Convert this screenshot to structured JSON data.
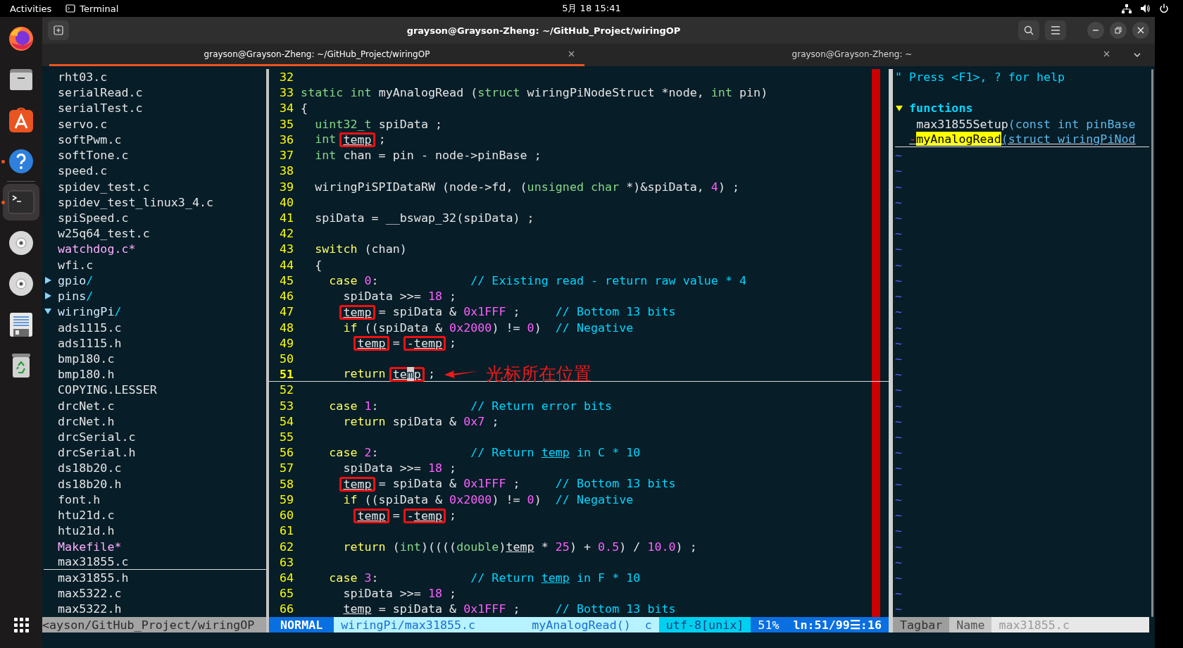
{
  "top_bar": {
    "activities": "Activities",
    "app": "Terminal",
    "clock": "5月 18 15:41"
  },
  "dock": {
    "items": [
      {
        "kind": "browser",
        "selected": false,
        "running": false
      },
      {
        "kind": "files",
        "selected": false,
        "running": false
      },
      {
        "kind": "store",
        "selected": false,
        "running": false
      },
      {
        "kind": "help",
        "selected": false,
        "running": true
      },
      {
        "kind": "terminal",
        "selected": true,
        "running": true
      },
      {
        "kind": "disc",
        "selected": false,
        "running": false
      },
      {
        "kind": "disc",
        "selected": false,
        "running": false
      },
      {
        "kind": "document",
        "selected": false,
        "running": false
      },
      {
        "kind": "trash",
        "selected": false,
        "running": false
      }
    ]
  },
  "window": {
    "title": "grayson@Grayson-Zheng: ~/GitHub_Project/wiringOP",
    "tabs": [
      {
        "label": "grayson@Grayson-Zheng: ~/GitHub_Project/wiringOP",
        "selected": true
      },
      {
        "label": "grayson@Grayson-Zheng: ~",
        "selected": false
      }
    ]
  },
  "tree": {
    "items": [
      {
        "kind": "group",
        "children": [
          {
            "kind": "file",
            "name": "rht03.c",
            "modified": false,
            "current": false
          },
          {
            "kind": "file",
            "name": "serialRead.c",
            "modified": false,
            "current": false
          },
          {
            "kind": "file",
            "name": "serialTest.c",
            "modified": false,
            "current": false
          },
          {
            "kind": "file",
            "name": "servo.c",
            "modified": false,
            "current": false
          },
          {
            "kind": "file",
            "name": "softPwm.c",
            "modified": false,
            "current": false
          },
          {
            "kind": "file",
            "name": "softTone.c",
            "modified": false,
            "current": false
          },
          {
            "kind": "file",
            "name": "speed.c",
            "modified": false,
            "current": false
          },
          {
            "kind": "file",
            "name": "spidev_test.c",
            "modified": false,
            "current": false
          },
          {
            "kind": "file",
            "name": "spidev_test_linux3_4.c",
            "modified": false,
            "current": false
          },
          {
            "kind": "file",
            "name": "spiSpeed.c",
            "modified": false,
            "current": false
          },
          {
            "kind": "file",
            "name": "w25q64_test.c",
            "modified": false,
            "current": false
          },
          {
            "kind": "file",
            "name": "watchdog.c*",
            "modified": true,
            "current": false
          },
          {
            "kind": "file",
            "name": "wfi.c",
            "modified": false,
            "current": false
          }
        ]
      },
      {
        "kind": "dir",
        "name": "gpio",
        "suffix": "/",
        "expanded": false
      },
      {
        "kind": "dir",
        "name": "pins",
        "suffix": "/",
        "expanded": false
      },
      {
        "kind": "dir",
        "name": "wiringPi",
        "suffix": "/",
        "expanded": true,
        "children": [
          {
            "kind": "file",
            "name": "ads1115.c",
            "modified": false,
            "current": false
          },
          {
            "kind": "file",
            "name": "ads1115.h",
            "modified": false,
            "current": false
          },
          {
            "kind": "file",
            "name": "bmp180.c",
            "modified": false,
            "current": false
          },
          {
            "kind": "file",
            "name": "bmp180.h",
            "modified": false,
            "current": false
          },
          {
            "kind": "file",
            "name": "COPYING.LESSER",
            "modified": false,
            "current": false
          },
          {
            "kind": "file",
            "name": "drcNet.c",
            "modified": false,
            "current": false
          },
          {
            "kind": "file",
            "name": "drcNet.h",
            "modified": false,
            "current": false
          },
          {
            "kind": "file",
            "name": "drcSerial.c",
            "modified": false,
            "current": false
          },
          {
            "kind": "file",
            "name": "drcSerial.h",
            "modified": false,
            "current": false
          },
          {
            "kind": "file",
            "name": "ds18b20.c",
            "modified": false,
            "current": false
          },
          {
            "kind": "file",
            "name": "ds18b20.h",
            "modified": false,
            "current": false
          },
          {
            "kind": "file",
            "name": "font.h",
            "modified": false,
            "current": false
          },
          {
            "kind": "file",
            "name": "htu21d.c",
            "modified": false,
            "current": false
          },
          {
            "kind": "file",
            "name": "htu21d.h",
            "modified": false,
            "current": false
          },
          {
            "kind": "file",
            "name": "Makefile*",
            "modified": true,
            "current": false
          },
          {
            "kind": "file",
            "name": "max31855.c",
            "modified": false,
            "current": true
          },
          {
            "kind": "file",
            "name": "max31855.h",
            "modified": false,
            "current": false
          },
          {
            "kind": "file",
            "name": "max5322.c",
            "modified": false,
            "current": false
          },
          {
            "kind": "file",
            "name": "max5322.h",
            "modified": false,
            "current": false
          }
        ]
      }
    ],
    "status": "<ayson/GitHub_Project/wiringOP"
  },
  "editor": {
    "lines": [
      {
        "num": "32",
        "current": false
      },
      {
        "num": "33",
        "current": false,
        "tokens": [
          {
            "kind": "type",
            "text": "static int"
          },
          {
            "kind": "plain",
            "text": " myAnalogRead ("
          },
          {
            "kind": "type",
            "text": "struct"
          },
          {
            "kind": "plain",
            "text": " wiringPiNodeStruct *node, "
          },
          {
            "kind": "type",
            "text": "int"
          },
          {
            "kind": "plain",
            "text": " pin)"
          }
        ]
      },
      {
        "num": "34",
        "current": false,
        "tokens": [
          {
            "kind": "plain",
            "text": "{"
          }
        ]
      },
      {
        "num": "35",
        "current": false,
        "tokens": [
          {
            "kind": "type",
            "text": "  uint32_t"
          },
          {
            "kind": "plain",
            "text": " spiData ;"
          }
        ]
      },
      {
        "num": "36",
        "current": false,
        "tokens": [
          {
            "kind": "type",
            "text": "  int "
          },
          {
            "kind": "box",
            "tokens": [
              {
                "kind": "match",
                "text": "temp"
              }
            ]
          },
          {
            "kind": "plain",
            "text": " ;"
          }
        ]
      },
      {
        "num": "37",
        "current": false,
        "tokens": [
          {
            "kind": "type",
            "text": "  int"
          },
          {
            "kind": "plain",
            "text": " chan = pin - node->pinBase ;"
          }
        ]
      },
      {
        "num": "38",
        "current": false
      },
      {
        "num": "39",
        "current": false,
        "tokens": [
          {
            "kind": "plain",
            "text": "  wiringPiSPIDataRW (node->fd, ("
          },
          {
            "kind": "type",
            "text": "unsigned char"
          },
          {
            "kind": "plain",
            "text": " *)&spiData, "
          },
          {
            "kind": "number",
            "text": "4"
          },
          {
            "kind": "plain",
            "text": ") ;"
          }
        ]
      },
      {
        "num": "40",
        "current": false
      },
      {
        "num": "41",
        "current": false,
        "tokens": [
          {
            "kind": "plain",
            "text": "  spiData = __bswap_32(spiData) ;"
          }
        ]
      },
      {
        "num": "42",
        "current": false
      },
      {
        "num": "43",
        "current": false,
        "tokens": [
          {
            "kind": "keyword",
            "text": "  switch"
          },
          {
            "kind": "plain",
            "text": " (chan)"
          }
        ]
      },
      {
        "num": "44",
        "current": false,
        "tokens": [
          {
            "kind": "plain",
            "text": "  {"
          }
        ]
      },
      {
        "num": "45",
        "current": false,
        "tokens": [
          {
            "kind": "keyword",
            "text": "    case"
          },
          {
            "kind": "number",
            "text": " 0"
          },
          {
            "kind": "plain",
            "text": ":             "
          },
          {
            "kind": "comment",
            "text": "// Existing read - return raw value * 4"
          }
        ]
      },
      {
        "num": "46",
        "current": false,
        "tokens": [
          {
            "kind": "plain",
            "text": "      spiData >>= "
          },
          {
            "kind": "number",
            "text": "18"
          },
          {
            "kind": "plain",
            "text": " ;"
          }
        ]
      },
      {
        "num": "47",
        "current": false,
        "tokens": [
          {
            "kind": "box",
            "tokens": [
              {
                "kind": "match",
                "text": "      temp"
              }
            ]
          },
          {
            "kind": "plain",
            "text": " = spiData & "
          },
          {
            "kind": "number",
            "text": "0x1FFF"
          },
          {
            "kind": "plain",
            "text": " ;     "
          },
          {
            "kind": "comment",
            "text": "// Bottom 13 bits"
          }
        ]
      },
      {
        "num": "48",
        "current": false,
        "tokens": [
          {
            "kind": "keyword",
            "text": "      if"
          },
          {
            "kind": "plain",
            "text": " ((spiData & "
          },
          {
            "kind": "number",
            "text": "0x2000"
          },
          {
            "kind": "plain",
            "text": ") != "
          },
          {
            "kind": "number",
            "text": "0"
          },
          {
            "kind": "plain",
            "text": ")  "
          },
          {
            "kind": "comment",
            "text": "// Negative"
          }
        ]
      },
      {
        "num": "49",
        "current": false,
        "tokens": [
          {
            "kind": "box",
            "tokens": [
              {
                "kind": "match",
                "text": "        temp"
              }
            ]
          },
          {
            "kind": "plain",
            "text": " = "
          },
          {
            "kind": "box",
            "tokens": [
              {
                "kind": "plain",
                "text": "-"
              },
              {
                "kind": "match",
                "text": "temp"
              }
            ]
          },
          {
            "kind": "plain",
            "text": " ;"
          }
        ]
      },
      {
        "num": "50",
        "current": false
      },
      {
        "num": "51",
        "current": true,
        "tokens": [
          {
            "kind": "keyword",
            "text": "      return "
          },
          {
            "kind": "box",
            "tokens": [
              {
                "kind": "match",
                "text": "te"
              },
              {
                "kind": "cursor",
                "text": "m"
              },
              {
                "kind": "match",
                "text": "p"
              }
            ]
          },
          {
            "kind": "plain",
            "text": " ;"
          }
        ],
        "note": {
          "text": "光标所在位置"
        }
      },
      {
        "num": "52",
        "current": false
      },
      {
        "num": "53",
        "current": false,
        "tokens": [
          {
            "kind": "keyword",
            "text": "    case"
          },
          {
            "kind": "number",
            "text": " 1"
          },
          {
            "kind": "plain",
            "text": ":             "
          },
          {
            "kind": "comment",
            "text": "// Return error bits"
          }
        ]
      },
      {
        "num": "54",
        "current": false,
        "tokens": [
          {
            "kind": "keyword",
            "text": "      return"
          },
          {
            "kind": "plain",
            "text": " spiData & "
          },
          {
            "kind": "number",
            "text": "0x7"
          },
          {
            "kind": "plain",
            "text": " ;"
          }
        ]
      },
      {
        "num": "55",
        "current": false
      },
      {
        "num": "56",
        "current": false,
        "tokens": [
          {
            "kind": "keyword",
            "text": "    case"
          },
          {
            "kind": "number",
            "text": " 2"
          },
          {
            "kind": "plain",
            "text": ":             "
          },
          {
            "kind": "comment",
            "text": "// Return "
          },
          {
            "kind": "comment-match",
            "text": "temp"
          },
          {
            "kind": "comment",
            "text": " in C * 10"
          }
        ]
      },
      {
        "num": "57",
        "current": false,
        "tokens": [
          {
            "kind": "plain",
            "text": "      spiData >>= "
          },
          {
            "kind": "number",
            "text": "18"
          },
          {
            "kind": "plain",
            "text": " ;"
          }
        ]
      },
      {
        "num": "58",
        "current": false,
        "tokens": [
          {
            "kind": "box",
            "tokens": [
              {
                "kind": "match",
                "text": "      temp"
              }
            ]
          },
          {
            "kind": "plain",
            "text": " = spiData & "
          },
          {
            "kind": "number",
            "text": "0x1FFF"
          },
          {
            "kind": "plain",
            "text": " ;     "
          },
          {
            "kind": "comment",
            "text": "// Bottom 13 bits"
          }
        ]
      },
      {
        "num": "59",
        "current": false,
        "tokens": [
          {
            "kind": "keyword",
            "text": "      if"
          },
          {
            "kind": "plain",
            "text": " ((spiData & "
          },
          {
            "kind": "number",
            "text": "0x2000"
          },
          {
            "kind": "plain",
            "text": ") != "
          },
          {
            "kind": "number",
            "text": "0"
          },
          {
            "kind": "plain",
            "text": ")  "
          },
          {
            "kind": "comment",
            "text": "// Negative"
          }
        ]
      },
      {
        "num": "60",
        "current": false,
        "tokens": [
          {
            "kind": "box",
            "tokens": [
              {
                "kind": "match",
                "text": "        temp"
              }
            ]
          },
          {
            "kind": "plain",
            "text": " = "
          },
          {
            "kind": "box",
            "tokens": [
              {
                "kind": "plain",
                "text": "-"
              },
              {
                "kind": "match",
                "text": "temp"
              }
            ]
          },
          {
            "kind": "plain",
            "text": " ;"
          }
        ]
      },
      {
        "num": "61",
        "current": false
      },
      {
        "num": "62",
        "current": false,
        "tokens": [
          {
            "kind": "keyword",
            "text": "      return"
          },
          {
            "kind": "plain",
            "text": " ("
          },
          {
            "kind": "type",
            "text": "int"
          },
          {
            "kind": "plain",
            "text": ")(((("
          },
          {
            "kind": "type",
            "text": "double"
          },
          {
            "kind": "plain",
            "text": ")"
          },
          {
            "kind": "match",
            "text": "temp"
          },
          {
            "kind": "plain",
            "text": " * "
          },
          {
            "kind": "number",
            "text": "25"
          },
          {
            "kind": "plain",
            "text": ") + "
          },
          {
            "kind": "number",
            "text": "0.5"
          },
          {
            "kind": "plain",
            "text": ") / "
          },
          {
            "kind": "number",
            "text": "10.0"
          },
          {
            "kind": "plain",
            "text": ") ;"
          }
        ]
      },
      {
        "num": "63",
        "current": false
      },
      {
        "num": "64",
        "current": false,
        "tokens": [
          {
            "kind": "keyword",
            "text": "    case"
          },
          {
            "kind": "number",
            "text": " 3"
          },
          {
            "kind": "plain",
            "text": ":             "
          },
          {
            "kind": "comment",
            "text": "// Return "
          },
          {
            "kind": "comment-match",
            "text": "temp"
          },
          {
            "kind": "comment",
            "text": " in F * 10"
          }
        ]
      },
      {
        "num": "65",
        "current": false,
        "tokens": [
          {
            "kind": "plain",
            "text": "      spiData >>= "
          },
          {
            "kind": "number",
            "text": "18"
          },
          {
            "kind": "plain",
            "text": " ;"
          }
        ]
      },
      {
        "num": "66",
        "current": false,
        "tokens": [
          {
            "kind": "match",
            "text": "      temp"
          },
          {
            "kind": "plain",
            "text": " = spiData & "
          },
          {
            "kind": "number",
            "text": "0x1FFF"
          },
          {
            "kind": "plain",
            "text": " ;     "
          },
          {
            "kind": "comment",
            "text": "// Bottom 13 bits"
          }
        ]
      }
    ],
    "status": [
      {
        "kind": "mode",
        "text": "NORMAL"
      },
      {
        "kind": "file",
        "text": "wiringPi/max31855.c"
      },
      {
        "kind": "function",
        "text": "myAnalogRead()"
      },
      {
        "kind": "filetype",
        "text": "c"
      },
      {
        "kind": "encoding",
        "text": "utf-8[unix]"
      },
      {
        "kind": "percent",
        "text": "51%"
      },
      {
        "kind": "position",
        "text": "ln:51/99☰:16"
      }
    ]
  },
  "tagbar": {
    "help": "\" Press <F1>, ? for help",
    "groups": [
      {
        "name": "functions",
        "expanded": true,
        "tags": [
          {
            "name": "max31855Setup",
            "signature": "(const int pinBase",
            "selected": false
          },
          {
            "marker": "-",
            "name": "myAnalogRead",
            "signature": "(struct wiringPiNod",
            "selected": true
          }
        ]
      }
    ],
    "filler": [
      "~",
      "~",
      "~",
      "~",
      "~",
      "~",
      "~",
      "~",
      "~",
      "~",
      "~",
      "~",
      "~",
      "~",
      "~",
      "~",
      "~",
      "~",
      "~",
      "~",
      "~",
      "~",
      "~",
      "~",
      "~",
      "~",
      "~",
      "~",
      "~",
      "~"
    ],
    "status": [
      {
        "kind": "plugin",
        "text": "Tagbar"
      },
      {
        "kind": "sort",
        "text": "Name"
      },
      {
        "kind": "file",
        "text": "max31855.c"
      }
    ]
  }
}
